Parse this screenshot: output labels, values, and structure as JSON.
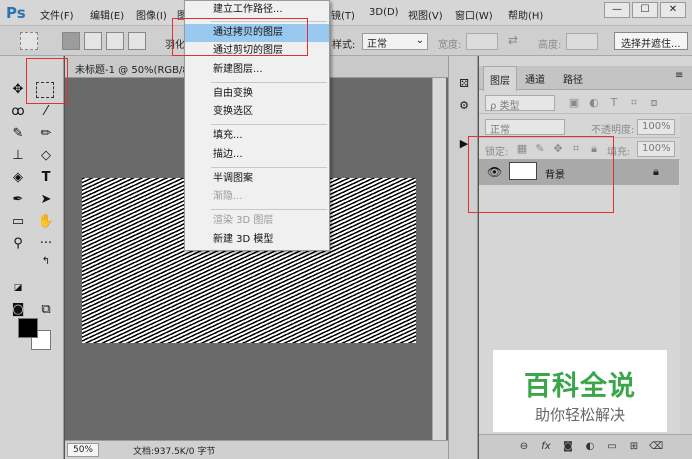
{
  "app": {
    "logo": "Ps"
  },
  "menubar": {
    "items": [
      "文件(F)",
      "编辑(E)",
      "图像(I)",
      "图",
      "镜(T)",
      "3D(D)",
      "视图(V)",
      "窗口(W)",
      "帮助(H)"
    ],
    "window_controls": [
      "—",
      "☐",
      "✕"
    ]
  },
  "options_bar": {
    "feather_label": "羽化",
    "style_label": "样式:",
    "style_value": "正常",
    "width_label": "宽度:",
    "height_label": "高度:",
    "select_mask_button": "选择并遮住..."
  },
  "document": {
    "title": "未标题-1 @ 50%(RGB/8)",
    "zoom": "50%",
    "info": "文档:937.5K/0 字节"
  },
  "context_menu": {
    "items": [
      {
        "label": "建立工作路径...",
        "state": "normal"
      },
      {
        "label": "通过拷贝的图层",
        "state": "highlighted"
      },
      {
        "label": "通过剪切的图层",
        "state": "normal"
      },
      {
        "label": "新建图层...",
        "state": "normal"
      },
      {
        "label": "自由变换",
        "state": "normal"
      },
      {
        "label": "变换选区",
        "state": "normal"
      },
      {
        "label": "填充...",
        "state": "normal"
      },
      {
        "label": "描边...",
        "state": "normal"
      },
      {
        "label": "半调图案",
        "state": "normal"
      },
      {
        "label": "渐隐...",
        "state": "disabled"
      },
      {
        "label": "渲染 3D 图层",
        "state": "disabled"
      },
      {
        "label": "新建 3D 模型",
        "state": "normal"
      }
    ]
  },
  "layers_panel": {
    "tabs": [
      "图层",
      "通道",
      "路径"
    ],
    "active_tab": "图层",
    "filter_kind": "ρ 类型",
    "blend_mode": "正常",
    "opacity_label": "不透明度:",
    "opacity_value": "100%",
    "lock_label": "锁定:",
    "fill_label": "填充:",
    "fill_value": "100%",
    "layers": [
      {
        "name": "背景",
        "visible": true,
        "locked": true
      }
    ]
  },
  "watermark": {
    "title": "百科全说",
    "subtitle": "助你轻松解决"
  },
  "colors": {
    "foreground": "#000000",
    "background": "#ffffff",
    "menu_highlight": "#99c9ef",
    "annotation": "#e03232",
    "watermark_green": "#3aa64a"
  }
}
